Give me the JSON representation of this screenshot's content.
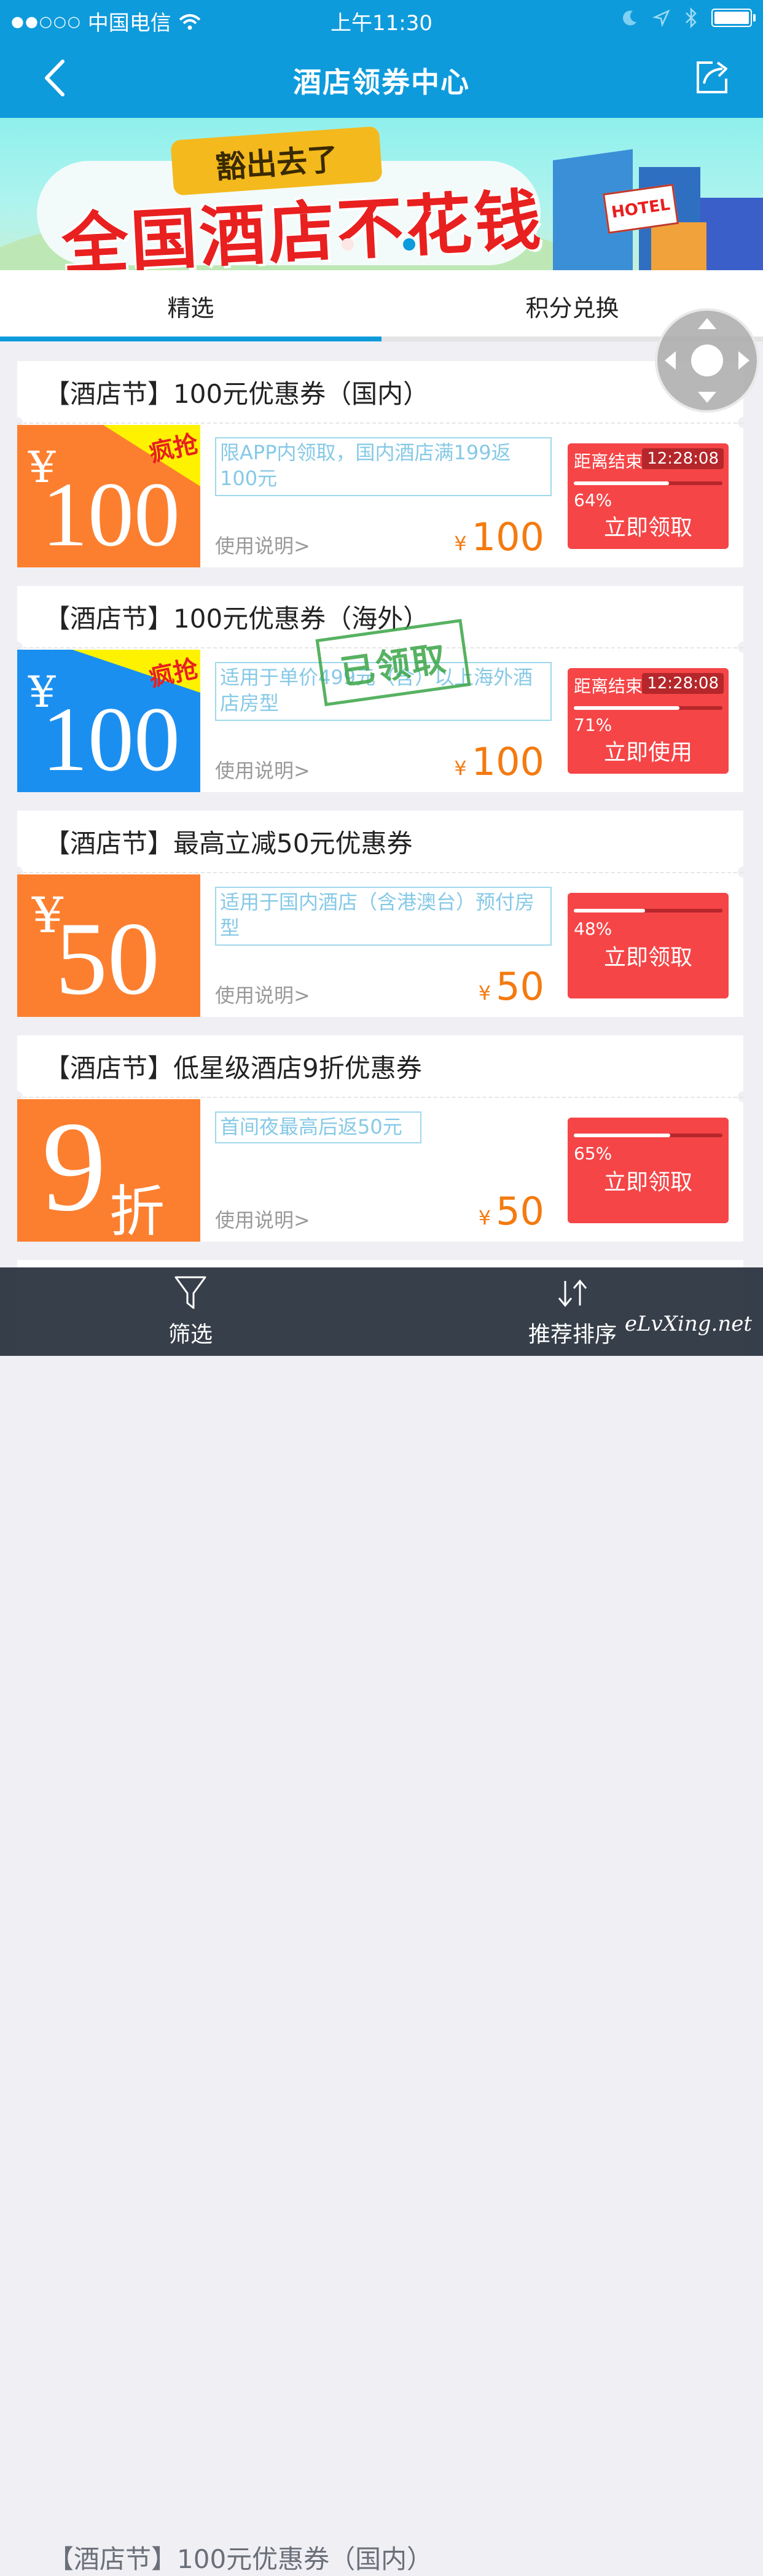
{
  "status_bar": {
    "signal": "●●○○○",
    "carrier": "中国电信",
    "time": "上午11:30"
  },
  "nav": {
    "title": "酒店领券中心",
    "back_icon": "chevron-left-icon",
    "share_icon": "share-icon"
  },
  "banner": {
    "tagline": "豁出去了",
    "slogan": "全国酒店不花钱",
    "sign": "HOTEL",
    "active_dot": 2,
    "dot_count": 2
  },
  "tabs": [
    {
      "label": "精选",
      "active": true
    },
    {
      "label": "积分兑换",
      "active": false
    }
  ],
  "colors": {
    "primary": "#0e9bdc",
    "orange": "#fc7f2f",
    "blue": "#1b8ff0",
    "red": "#f54547",
    "price": "#f47a0f"
  },
  "coupons": [
    {
      "title": "【酒店节】100元优惠券（国内）",
      "badge_symbol": "¥",
      "badge_value": "100",
      "badge_corner": "疯抢",
      "desc": "限APP内领取，国内酒店满199返100元",
      "usage": "使用说明>",
      "price_symbol": "¥",
      "price": "100",
      "deadline_label": "距离结束",
      "countdown": "12:28:08",
      "progress": 0.64,
      "progress_label": "64%",
      "action": "立即领取"
    },
    {
      "title": "【酒店节】100元优惠券（海外）",
      "badge_symbol": "¥",
      "badge_value": "100",
      "badge_corner": "疯抢",
      "desc": "适用于单价499元（含）以上海外酒店房型",
      "usage": "使用说明>",
      "price_symbol": "¥",
      "price": "100",
      "deadline_label": "距离结束",
      "countdown": "12:28:08",
      "progress": 0.71,
      "progress_label": "71%",
      "action": "立即使用",
      "stamp": "已领取"
    },
    {
      "title": "【酒店节】最高立减50元优惠券",
      "badge_symbol": "¥",
      "badge_value": "50",
      "desc": "适用于国内酒店（含港澳台）预付房型",
      "usage": "使用说明>",
      "price_symbol": "¥",
      "price": "50",
      "progress": 0.48,
      "progress_label": "48%",
      "action": "立即领取"
    },
    {
      "title": "【酒店节】低星级酒店9折优惠券",
      "badge_value": "9",
      "badge_unit": "折",
      "desc": "首间夜最高后返50元",
      "usage": "使用说明>",
      "price_symbol": "¥",
      "price": "50",
      "progress": 0.65,
      "progress_label": "65%",
      "action": "立即领取"
    }
  ],
  "partial_card_title": "【酒店节】100元优惠券（国内）",
  "bottom_bar": {
    "filter_label": "筛选",
    "filter_icon": "filter-funnel-icon",
    "sort_label": "推荐排序",
    "sort_icon": "sort-arrows-icon"
  },
  "watermark": "eLvXing.net"
}
